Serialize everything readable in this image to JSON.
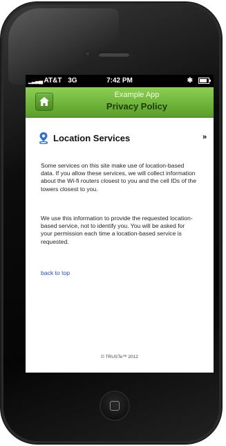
{
  "status_bar": {
    "carrier": "AT&T",
    "network": "3G",
    "time": "7:42 PM"
  },
  "header": {
    "app_name": "Example App",
    "page_title": "Privacy Policy",
    "accent_color": "#6bb43a"
  },
  "section": {
    "heading": "Location Services",
    "collapse_glyph": "»",
    "paragraphs": [
      "Some services on this site make use of location-based data. If you allow these services, we will collect information about the Wi-fi routers closest to you and the cell IDs of the towers closest to you.",
      "We use this information to provide the requested location-based service, not to identify you. You will be asked for your permission each time a location-based service is requested."
    ],
    "back_link": "back to top"
  },
  "footer": {
    "copyright": "© TRUSTe™ 2012"
  },
  "icons": {
    "home": "home-icon",
    "location": "location-pin-icon",
    "bluetooth": "bluetooth-icon",
    "battery": "battery-icon"
  }
}
